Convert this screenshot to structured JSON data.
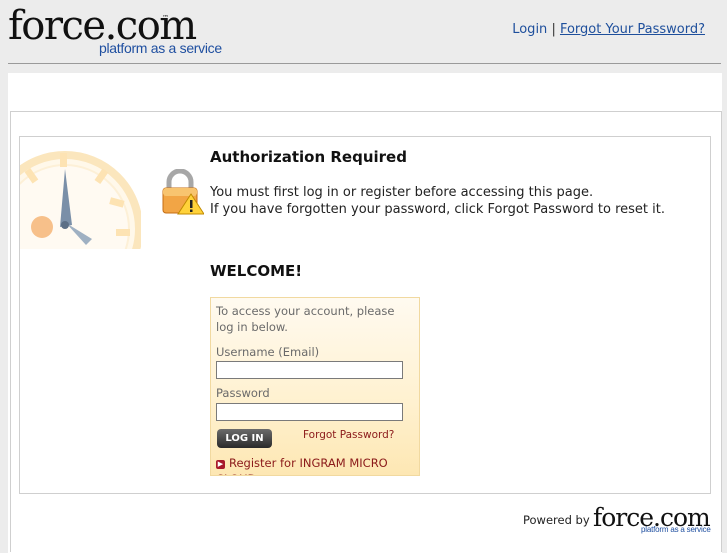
{
  "header": {
    "logo_word": "force.com",
    "logo_tm": "™",
    "logo_tagline": "platform as a service",
    "login_label": "Login",
    "separator": "|",
    "forgot_password_label": "Forgot Your Password?"
  },
  "auth": {
    "title": "Authorization Required",
    "message_line1": "You must first log in or register before accessing this page.",
    "message_line2": "If you have forgotten your password, click Forgot Password to reset it."
  },
  "login": {
    "welcome": "WELCOME!",
    "intro": "To access your account, please log in below.",
    "username_label": "Username (Email)",
    "username_value": "",
    "password_label": "Password",
    "password_value": "",
    "login_button": "LOG IN",
    "forgot_password": "Forgot Password?",
    "register_link": "Register for INGRAM MICRO CLOUD"
  },
  "footer": {
    "powered_by": "Powered by",
    "logo_word": "force.com",
    "logo_tagline": "platform as a service"
  },
  "colors": {
    "link": "#1e4f9c",
    "accent_red": "#8b1a1a",
    "tagline_blue": "#1f4fa0",
    "login_panel": "#fff1cf"
  },
  "icons": [
    "clock-icon",
    "lock-warning-icon",
    "arrow-right-icon"
  ]
}
